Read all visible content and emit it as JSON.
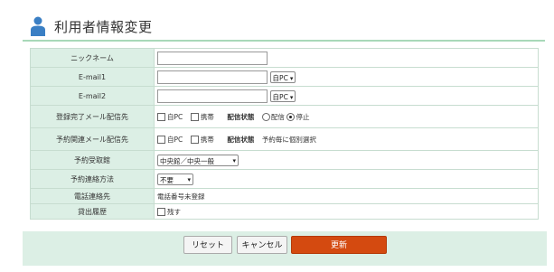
{
  "header": {
    "title": "利用者情報変更",
    "icon": "user-icon"
  },
  "form": {
    "nickname": {
      "label": "ニックネーム",
      "value": ""
    },
    "email1": {
      "label": "E-mail1",
      "value": "",
      "type_selected": "自PC"
    },
    "email2": {
      "label": "E-mail2",
      "value": "",
      "type_selected": "自PC"
    },
    "register_mail": {
      "label": "登録完了メール配信先",
      "opt_pc": "自PC",
      "opt_mobile": "携帯",
      "status_label": "配信状態",
      "status_on": "配信",
      "status_off": "停止",
      "status_selected": "停止"
    },
    "reservation_mail": {
      "label": "予約関連メール配信先",
      "opt_pc": "自PC",
      "opt_mobile": "携帯",
      "status_label": "配信状態",
      "status_text": "予約毎に個別選択"
    },
    "pickup_library": {
      "label": "予約受取館",
      "selected": "中央館／中央一般"
    },
    "contact_method": {
      "label": "予約連絡方法",
      "selected": "不要"
    },
    "phone": {
      "label": "電話連絡先",
      "value": "電話番号未登録"
    },
    "history": {
      "label": "貸出履歴",
      "option": "残す"
    }
  },
  "buttons": {
    "reset": "リセット",
    "cancel": "キャンセル",
    "update": "更新"
  },
  "colors": {
    "label_bg": "#dcefe5",
    "update_button": "#d44a10",
    "header_rule": "#a8d8b9"
  }
}
